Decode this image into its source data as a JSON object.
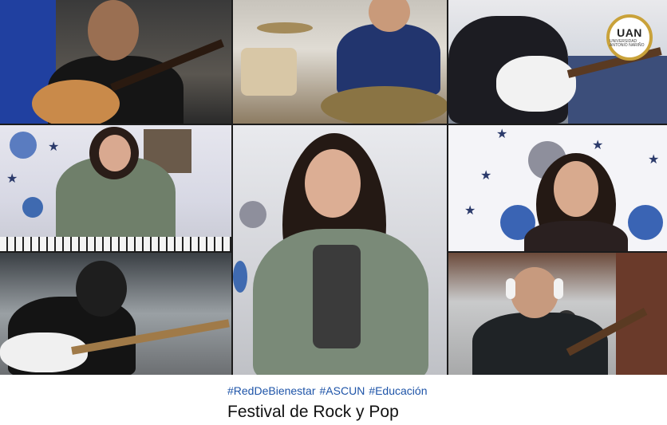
{
  "video": {
    "participants": [
      {
        "id": "guitarist-acoustic",
        "instrument": "acoustic guitar"
      },
      {
        "id": "drummer",
        "instrument": "drums"
      },
      {
        "id": "guitarist-electric",
        "instrument": "electric guitar"
      },
      {
        "id": "keyboardist",
        "instrument": "keyboard"
      },
      {
        "id": "lead-singer",
        "instrument": "vocals"
      },
      {
        "id": "backup-singer",
        "instrument": "vocals"
      },
      {
        "id": "bassist",
        "instrument": "bass"
      },
      {
        "id": "guitarist-headphones",
        "instrument": "electric guitar"
      }
    ],
    "logo_text": "UAN",
    "logo_subtext": "UNIVERSIDAD ANTONIO NARIÑO"
  },
  "caption": {
    "hashtags": [
      "#RedDeBienestar",
      "#ASCUN",
      "#Educación"
    ],
    "title": "Festival de Rock y Pop"
  },
  "colors": {
    "hashtag": "#1e54a8",
    "title": "#111111",
    "logo_ring": "#c9a23a"
  }
}
